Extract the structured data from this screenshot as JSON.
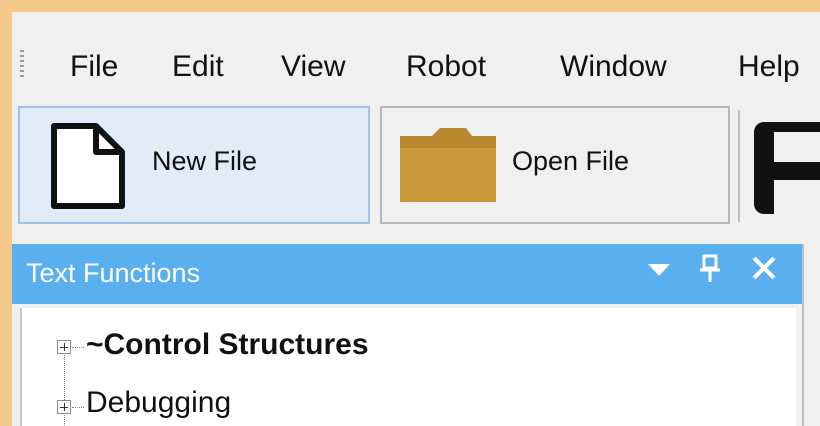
{
  "menu": {
    "items": [
      "File",
      "Edit",
      "View",
      "Robot",
      "Window",
      "Help"
    ]
  },
  "toolbar": {
    "buttons": [
      {
        "label": "New File",
        "icon": "new-file-icon",
        "active": true
      },
      {
        "label": "Open File",
        "icon": "folder-icon",
        "active": false
      }
    ],
    "partial_icon": "save-icon"
  },
  "panel": {
    "title": "Text Functions",
    "controls": [
      "dropdown-icon",
      "pin-icon",
      "close-icon"
    ],
    "header_color": "#5ab0ee"
  },
  "tree": {
    "items": [
      {
        "label": "~Control Structures",
        "bold": true
      },
      {
        "label": "Debugging",
        "bold": false
      }
    ]
  },
  "colors": {
    "frame": "#f5c98a",
    "active_button": "#e1ecf8",
    "folder": "#c89a3a"
  }
}
